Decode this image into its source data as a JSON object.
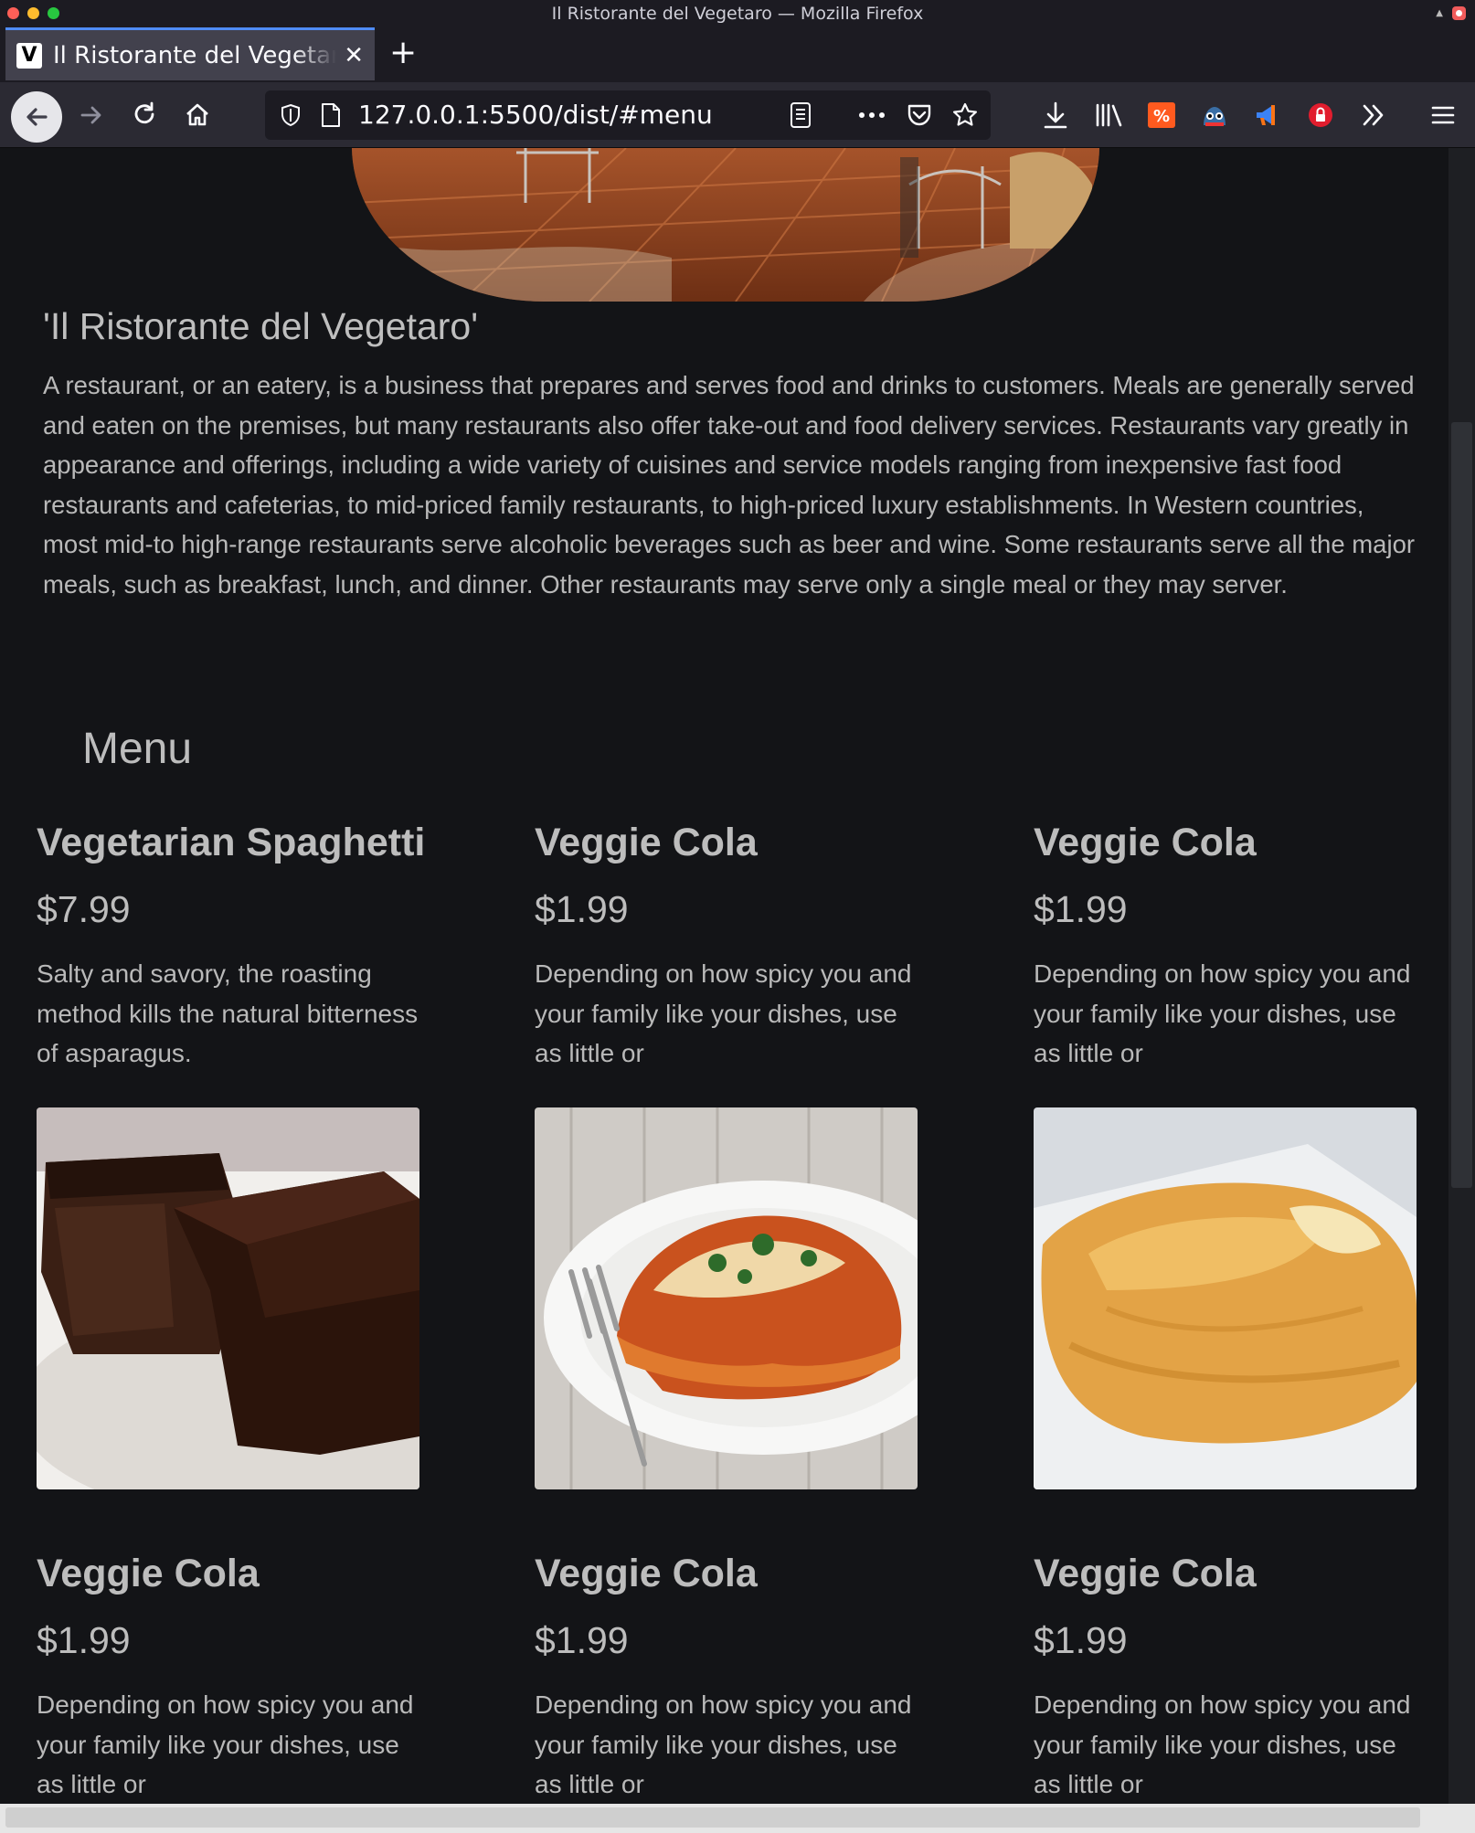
{
  "window": {
    "title": "Il Ristorante del Vegetaro — Mozilla Firefox"
  },
  "tab": {
    "favicon_letter": "V",
    "title": "Il Ristorante del Vegetaro",
    "close_glyph": "✕",
    "new_tab_glyph": "+"
  },
  "urlbar": {
    "url": "127.0.0.1:5500/dist/#menu"
  },
  "toolbar_icons": [
    "back-icon",
    "forward-icon",
    "reload-icon",
    "home-icon",
    "shield-icon",
    "page-icon",
    "reader-view-icon",
    "more-icon",
    "pocket-icon",
    "bookmark-star-icon",
    "download-icon",
    "library-icon",
    "extension-icon",
    "extension-icon",
    "extension-icon",
    "extension-icon",
    "overflow-icon",
    "hamburger-menu-icon"
  ],
  "about": {
    "title": "'Il Ristorante del Vegetaro'",
    "text": "A restaurant, or an eatery, is a business that prepares and serves food and drinks to customers. Meals are generally served and eaten on the premises, but many restaurants also offer take-out and food delivery services. Restaurants vary greatly in appearance and offerings, including a wide variety of cuisines and service models ranging from inexpensive fast food restaurants and cafeterias, to mid-priced family restaurants, to high-priced luxury establishments. In Western countries, most mid-to high-range restaurants serve alcoholic beverages such as beer and wine. Some restaurants serve all the major meals, such as breakfast, lunch, and dinner. Other restaurants may serve only a single meal or they may server."
  },
  "menu": {
    "heading": "Menu",
    "items": [
      {
        "name": "Vegetarian Spaghetti",
        "price": "$7.99",
        "description": "Salty and savory, the roasting method kills the natural bitterness of asparagus.",
        "image": "chocolate-brownie"
      },
      {
        "name": "Veggie Cola",
        "price": "$1.99",
        "description": "Depending on how spicy you and your family like your dishes, use as little or",
        "image": "lasagna-plate"
      },
      {
        "name": "Veggie Cola",
        "price": "$1.99",
        "description": "Depending on how spicy you and your family like your dishes, use as little or",
        "image": "stuffed-squash"
      },
      {
        "name": "Veggie Cola",
        "price": "$1.99",
        "description": "Depending on how spicy you and your family like your dishes, use as little or"
      },
      {
        "name": "Veggie Cola",
        "price": "$1.99",
        "description": "Depending on how spicy you and your family like your dishes, use as little or"
      },
      {
        "name": "Veggie Cola",
        "price": "$1.99",
        "description": "Depending on how spicy you and your family like your dishes, use as little or"
      }
    ]
  },
  "colors": {
    "page_bg": "#131417",
    "text": "#bdbdbd",
    "chrome_bg": "#2b2a33",
    "tab_accent": "#4f8cf7"
  }
}
